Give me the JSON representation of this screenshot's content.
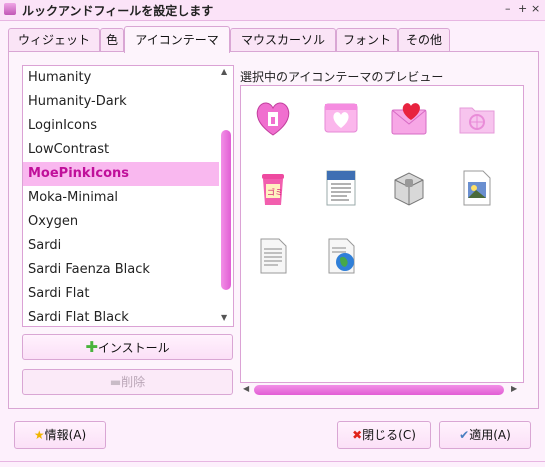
{
  "window": {
    "title": "ルックアンドフィールを設定します",
    "controls": [
      "–",
      "+",
      "×"
    ]
  },
  "tabs": [
    {
      "label": "ウィジェット",
      "active": false
    },
    {
      "label": "色",
      "active": false
    },
    {
      "label": "アイコンテーマ",
      "active": true
    },
    {
      "label": "マウスカーソル",
      "active": false
    },
    {
      "label": "フォント",
      "active": false
    },
    {
      "label": "その他",
      "active": false
    }
  ],
  "theme_list": {
    "items": [
      "Humanity",
      "Humanity-Dark",
      "LoginIcons",
      "LowContrast",
      "MoePinkIcons",
      "Moka-Minimal",
      "Oxygen",
      "Sardi",
      "Sardi Faenza Black",
      "Sardi Flat",
      "Sardi Flat Black"
    ],
    "selected": "MoePinkIcons"
  },
  "buttons": {
    "install": "インストール",
    "delete": "削除",
    "info": "情報(A)",
    "close": "閉じる(C)",
    "apply": "適用(A)"
  },
  "preview": {
    "label": "選択中のアイコンテーマのプレビュー",
    "icons": [
      "heart-home-icon",
      "pink-window-icon",
      "pink-mail-heart-icon",
      "pink-folder-icon",
      "trash-can-icon",
      "document-icon",
      "package-icon",
      "image-file-icon",
      "text-file-icon",
      "web-file-icon"
    ]
  },
  "colors": {
    "accent": "#e15ed4",
    "selection_bg": "#f9b8ef",
    "selection_text": "#c0109a",
    "window_bg": "#fdf0fc"
  }
}
